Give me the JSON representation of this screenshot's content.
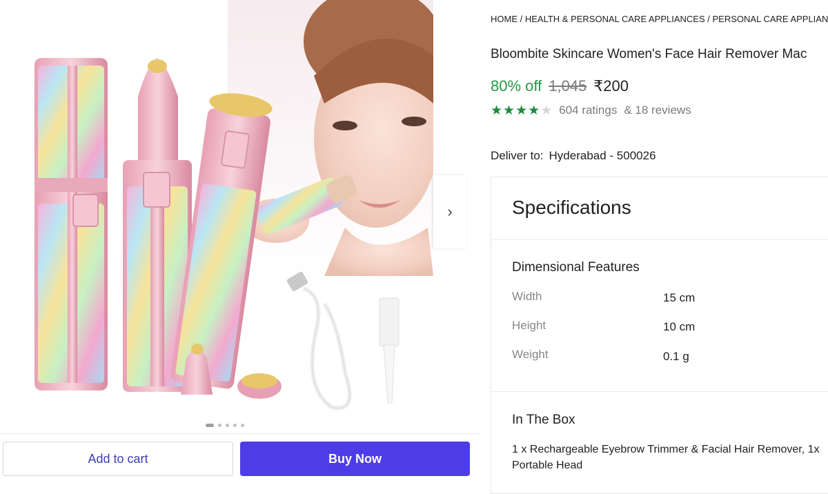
{
  "gallery": {
    "next_arrow": "›",
    "dots_count": 5,
    "active_dot": 0
  },
  "actions": {
    "add_to_cart": "Add to cart",
    "buy_now": "Buy Now"
  },
  "breadcrumb": {
    "items": [
      "HOME",
      "HEALTH & PERSONAL CARE APPLIANCES",
      "PERSONAL CARE APPLIANCES"
    ],
    "separator": " / "
  },
  "product": {
    "title": "Bloombite Skincare Women's Face Hair Remover Mac",
    "discount": "80% off",
    "mrp": "1,045",
    "price": "₹200",
    "rating_stars": 4,
    "rating_max": 5,
    "ratings": "604 ratings",
    "reviews": "& 18 reviews"
  },
  "delivery": {
    "label": "Deliver to:",
    "location": "Hyderabad - 500026"
  },
  "specifications": {
    "title": "Specifications",
    "dimensional": {
      "title": "Dimensional Features",
      "rows": [
        {
          "key": "Width",
          "value": "15 cm"
        },
        {
          "key": "Height",
          "value": "10 cm"
        },
        {
          "key": "Weight",
          "value": "0.1 g"
        }
      ]
    },
    "in_the_box": {
      "title": "In The Box",
      "line1": "1 x Rechargeable Eyebrow Trimmer & Facial Hair Remover, 1x",
      "line2": "Portable Head"
    }
  },
  "colors": {
    "discount_green": "#1e9a43",
    "star_green": "#1e8a3c",
    "buy_button": "#4c3de6",
    "cart_text": "#3b3fb0"
  }
}
